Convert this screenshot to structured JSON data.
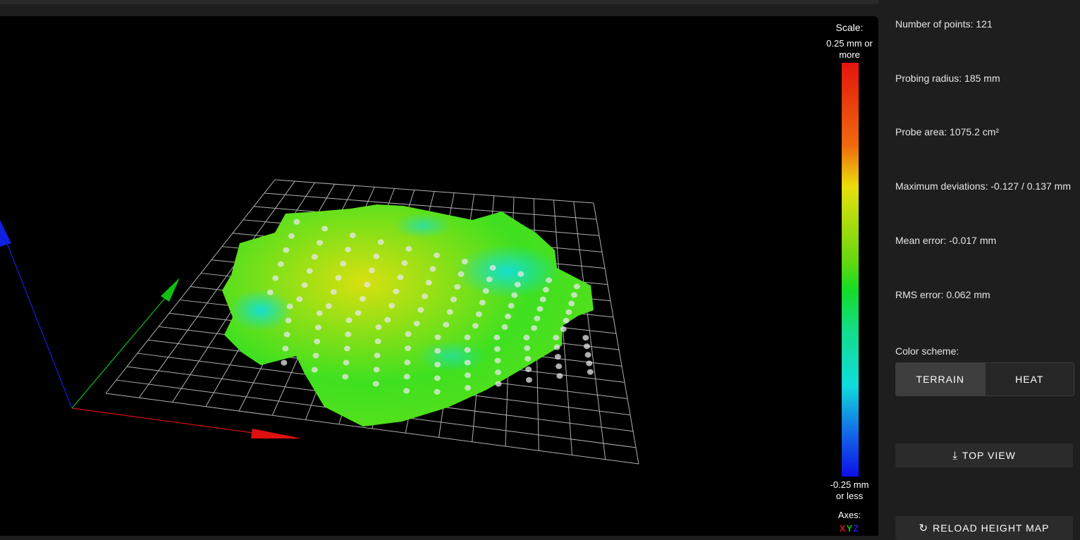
{
  "viewer": {
    "scale_title": "Scale:",
    "scale_max": "0.25 mm or more",
    "scale_min": "-0.25 mm or less",
    "axes_title": "Axes:",
    "axes_x": "X",
    "axes_y": "Y",
    "axes_z": "Z",
    "colors": {
      "x_axis": "#e01010",
      "y_axis": "#10c010",
      "z_axis": "#1020e0"
    }
  },
  "stats": {
    "points": "Number of points: 121",
    "radius": "Probing radius: 185 mm",
    "area": "Probe area: 1075.2 cm²",
    "deviations": "Maximum deviations: -0.127 / 0.137 mm",
    "mean": "Mean error: -0.017 mm",
    "rms": "RMS error: 0.062 mm"
  },
  "color_scheme": {
    "label": "Color scheme:",
    "options": [
      "TERRAIN",
      "HEAT"
    ],
    "selected": "TERRAIN"
  },
  "actions": {
    "top_view_icon": "download-arrow-icon",
    "top_view": "TOP VIEW",
    "reload_icon": "refresh-icon",
    "reload": "RELOAD HEIGHT MAP"
  }
}
